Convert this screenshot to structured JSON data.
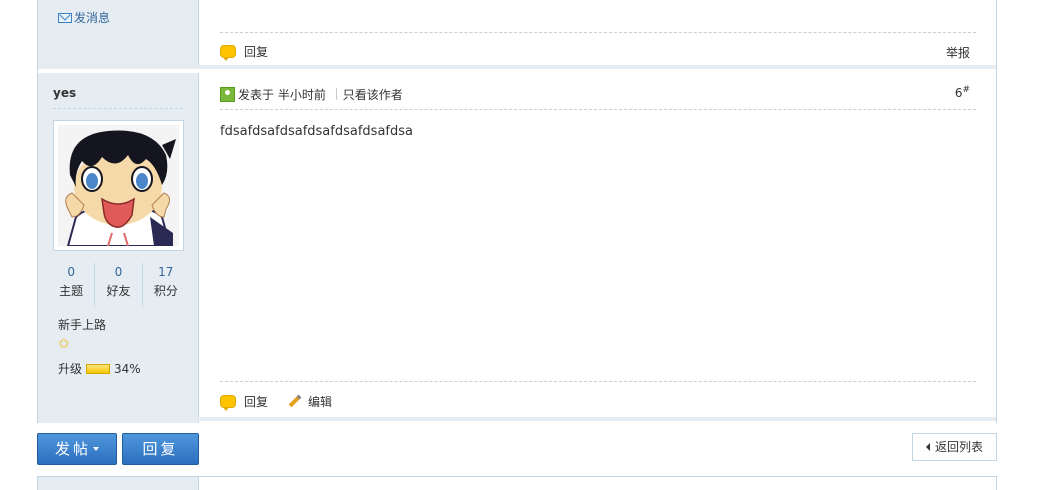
{
  "prev_post": {
    "send_message": "发消息",
    "reply": "回复",
    "report": "举报"
  },
  "post": {
    "author": "yes",
    "stats": [
      {
        "value": "0",
        "label": "主题"
      },
      {
        "value": "0",
        "label": "好友"
      },
      {
        "value": "17",
        "label": "积分"
      }
    ],
    "rank": "新手上路",
    "upgrade_label": "升级",
    "upgrade_percent": "34%",
    "posted_prefix": "发表于",
    "posted_time": "半小时前",
    "only_author": "只看该作者",
    "floor": "6",
    "floor_mark": "#",
    "content": "fdsafdsafdsafdsafdsafdsafdsa",
    "reply": "回复",
    "edit": "编辑"
  },
  "bottom_bar": {
    "new_post": "发帖",
    "reply": "回复",
    "back_to_list": "返回列表"
  },
  "colors": {
    "sidebar_bg": "#e5edf2",
    "border": "#c2d5e3",
    "button_blue": "#2b6fbe",
    "link": "#336699"
  }
}
